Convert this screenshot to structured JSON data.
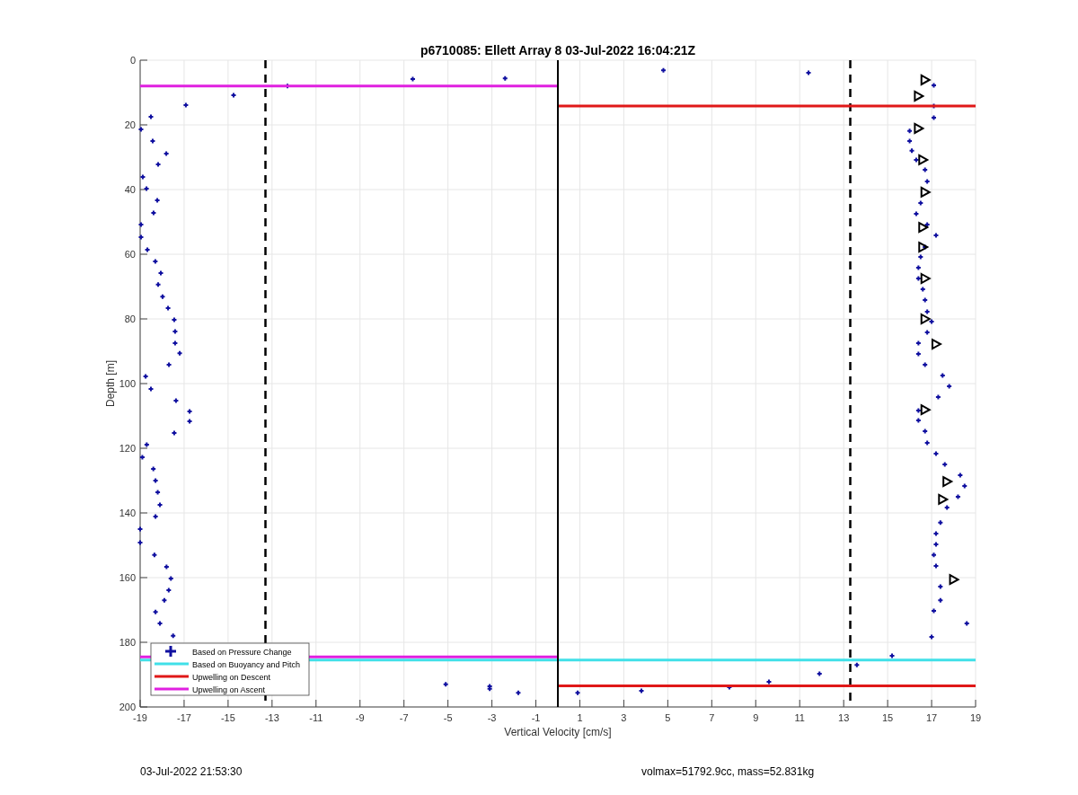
{
  "figure": {
    "chart_data": {
      "type": "scatter",
      "title": "p6710085: Ellett Array 8 03-Jul-2022 16:04:21Z",
      "xlabel": "Vertical Velocity [cm/s]",
      "ylabel": "Depth [m]",
      "xlim": [
        -19,
        19
      ],
      "ylim": [
        200,
        0
      ],
      "xticks": [
        -19,
        -17,
        -15,
        -13,
        -11,
        -9,
        -7,
        -5,
        -3,
        -1,
        1,
        3,
        5,
        7,
        9,
        11,
        13,
        15,
        17,
        19
      ],
      "yticks": [
        0,
        20,
        40,
        60,
        80,
        100,
        120,
        140,
        160,
        180,
        200
      ],
      "series": [
        {
          "name": "Based on Pressure Change",
          "type": "scatter",
          "marker": "plus",
          "color": "#1010a0",
          "x": [
            -14.75,
            -16.92,
            -18.51,
            -18.96,
            -18.43,
            -17.81,
            -18.18,
            -18.88,
            -18.71,
            -18.22,
            -18.39,
            -18.96,
            -18.96,
            -18.67,
            -18.31,
            -18.06,
            -18.18,
            -17.98,
            -17.73,
            -17.45,
            -17.41,
            -17.41,
            -17.2,
            -17.69,
            -18.75,
            -18.51,
            -17.37,
            -16.75,
            -16.75,
            -17.45,
            -18.7,
            -18.9,
            -18.4,
            -18.3,
            -18.2,
            -18.1,
            -18.3,
            -19,
            -19,
            -18.35,
            -17.8,
            -17.6,
            -17.7,
            -17.9,
            -18.3,
            -18.1,
            -17.5,
            -12.3,
            -6.6,
            -2.4,
            4.8,
            11.4,
            17.1,
            17.1,
            17.1,
            16,
            16,
            16.1,
            16.3,
            16.7,
            16.8,
            16.5,
            16.3,
            16.8,
            17.2,
            16.7,
            16.5,
            16.4,
            16.4,
            16.6,
            16.7,
            16.8,
            17,
            16.8,
            16.4,
            16.4,
            16.7,
            17.5,
            17.8,
            17.3,
            16.4,
            16.4,
            16.7,
            16.8,
            17.2,
            17.6,
            18.3,
            18.5,
            18.2,
            17.7,
            17.4,
            17.2,
            17.2,
            17.1,
            17.2,
            17.4,
            17.4,
            17.1,
            18.6,
            17,
            15.2,
            13.6,
            11.9,
            9.6,
            7.8,
            3.8,
            0.9,
            -1.8,
            -3.1,
            -3.1,
            -5.1
          ],
          "values": [
            10.8,
            13.9,
            17.5,
            21.4,
            25,
            28.9,
            32.2,
            36.1,
            39.7,
            43.3,
            47.2,
            50.8,
            54.7,
            58.6,
            62.2,
            65.8,
            69.4,
            73.1,
            76.7,
            80.3,
            83.9,
            87.5,
            90.6,
            94.2,
            97.8,
            101.7,
            105.3,
            108.6,
            111.7,
            115.3,
            118.9,
            122.8,
            126.4,
            130,
            133.6,
            137.5,
            141.1,
            145,
            149.2,
            153,
            156.7,
            160.3,
            163.9,
            167,
            170.6,
            174.2,
            178,
            8,
            5.8,
            5.6,
            3.1,
            3.9,
            7.8,
            14.2,
            17.8,
            21.9,
            25,
            28,
            30.8,
            33.9,
            37.5,
            44.2,
            47.5,
            50.8,
            54.2,
            57.8,
            60.8,
            64.2,
            67.5,
            70.8,
            74.2,
            77.8,
            80.8,
            84.2,
            87.5,
            90.8,
            94.2,
            97.5,
            100.8,
            104.2,
            108.3,
            111.4,
            114.7,
            118.3,
            121.7,
            125,
            128.3,
            131.7,
            135,
            138.3,
            143,
            146.4,
            149.7,
            153,
            156.4,
            162.8,
            167,
            170.3,
            174.2,
            178.3,
            184.2,
            187,
            189.7,
            192.2,
            193.9,
            195,
            195.6,
            195.6,
            194.4,
            193.6,
            193
          ]
        },
        {
          "name": "Based on Buoyancy and Pitch",
          "type": "line",
          "color": "#40e0e8",
          "x": [
            -19,
            19
          ],
          "values": [
            185.5,
            185.5
          ]
        },
        {
          "name": "Upwelling on Descent",
          "type": "line",
          "color": "#e01818",
          "x": [
            0,
            19
          ],
          "values": [
            14.2,
            14.2
          ]
        },
        {
          "name": "Upwelling on Ascent",
          "type": "line",
          "color": "#e020e0",
          "x": [
            -19,
            0
          ],
          "values": [
            8,
            8
          ]
        },
        {
          "type": "line",
          "color": "#e01818",
          "x": [
            0,
            19
          ],
          "values": [
            193.5,
            193.5
          ]
        },
        {
          "type": "line",
          "color": "#e020e0",
          "x": [
            -19,
            0
          ],
          "values": [
            184.5,
            184.5
          ]
        },
        {
          "type": "line",
          "color": "#000000",
          "x": [
            0,
            0
          ],
          "values": [
            0,
            200
          ]
        },
        {
          "type": "scatter",
          "marker": "triangle",
          "color": "#000000",
          "x": [
            16.7,
            16.4,
            16.4,
            16.6,
            16.7,
            16.6,
            16.6,
            16.7,
            16.7,
            17.2,
            16.7,
            17.7,
            17.5,
            18
          ],
          "values": [
            6.1,
            11.1,
            21.1,
            30.8,
            40.8,
            51.7,
            57.8,
            67.5,
            80,
            87.8,
            108.1,
            130.3,
            135.8,
            160.6
          ]
        }
      ],
      "ref_lines": [
        {
          "axis": "x",
          "value": -13.3
        },
        {
          "axis": "x",
          "value": 13.3
        }
      ],
      "grid": true,
      "legend": true
    }
  },
  "footer": {
    "timestamp": "03-Jul-2022 21:53:30",
    "summary": "volmax=51792.9cc, mass=52.831kg"
  }
}
